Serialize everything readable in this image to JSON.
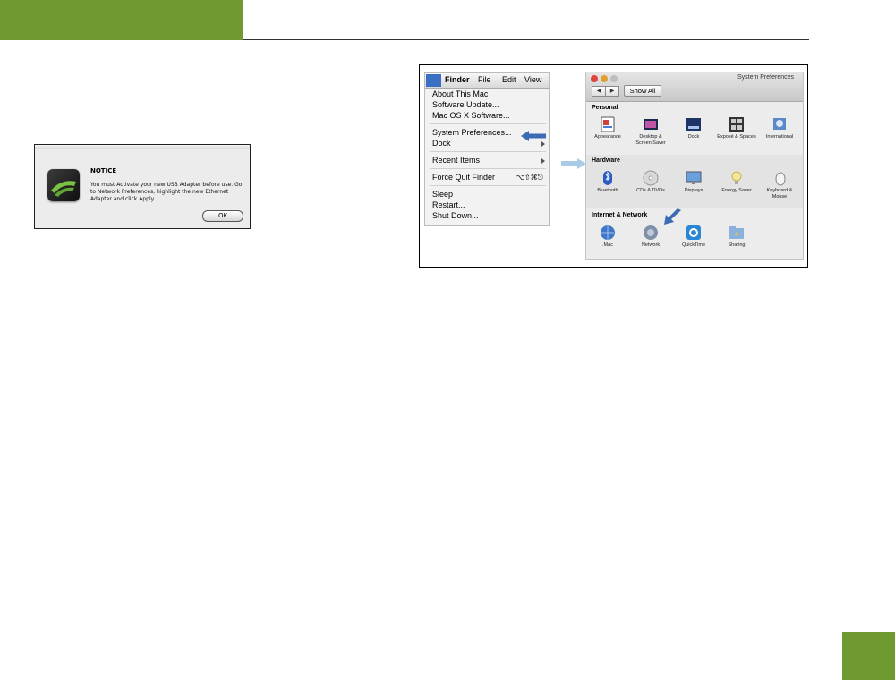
{
  "header": {
    "accent_color": "#6f9a32"
  },
  "notice_dialog": {
    "icon": "adapter-app-icon",
    "title": "NOTICE",
    "message": "You must Activate your new USB Adapter before use. Go to Network Preferences, highlight the new Ethernet Adapter and click Apply.",
    "ok_label": "OK"
  },
  "apple_menu": {
    "menubar": {
      "apple_icon": "apple-icon",
      "app": "Finder",
      "file": "File",
      "edit": "Edit",
      "view": "View"
    },
    "items": {
      "about": "About This Mac",
      "software_update": "Software Update...",
      "osx_software": "Mac OS X Software...",
      "system_preferences": "System Preferences...",
      "dock": "Dock",
      "recent_items": "Recent Items",
      "force_quit": "Force Quit Finder",
      "force_quit_shortcut": "⌥⇧⌘⎋",
      "sleep": "Sleep",
      "restart": "Restart...",
      "shut_down": "Shut Down..."
    },
    "highlight_arrow_color": "#3b6db4"
  },
  "system_preferences": {
    "title": "System Preferences",
    "show_all": "Show All",
    "sections": {
      "personal": {
        "title": "Personal",
        "items": [
          "Appearance",
          "Desktop & Screen Saver",
          "Dock",
          "Exposé & Spaces",
          "International"
        ]
      },
      "hardware": {
        "title": "Hardware",
        "items": [
          "Bluetooth",
          "CDs & DVDs",
          "Displays",
          "Energy Saver",
          "Keyboard & Mouse"
        ]
      },
      "internet": {
        "title": "Internet & Network",
        "items": [
          ".Mac",
          "Network",
          "QuickTime",
          "Sharing"
        ]
      }
    }
  }
}
